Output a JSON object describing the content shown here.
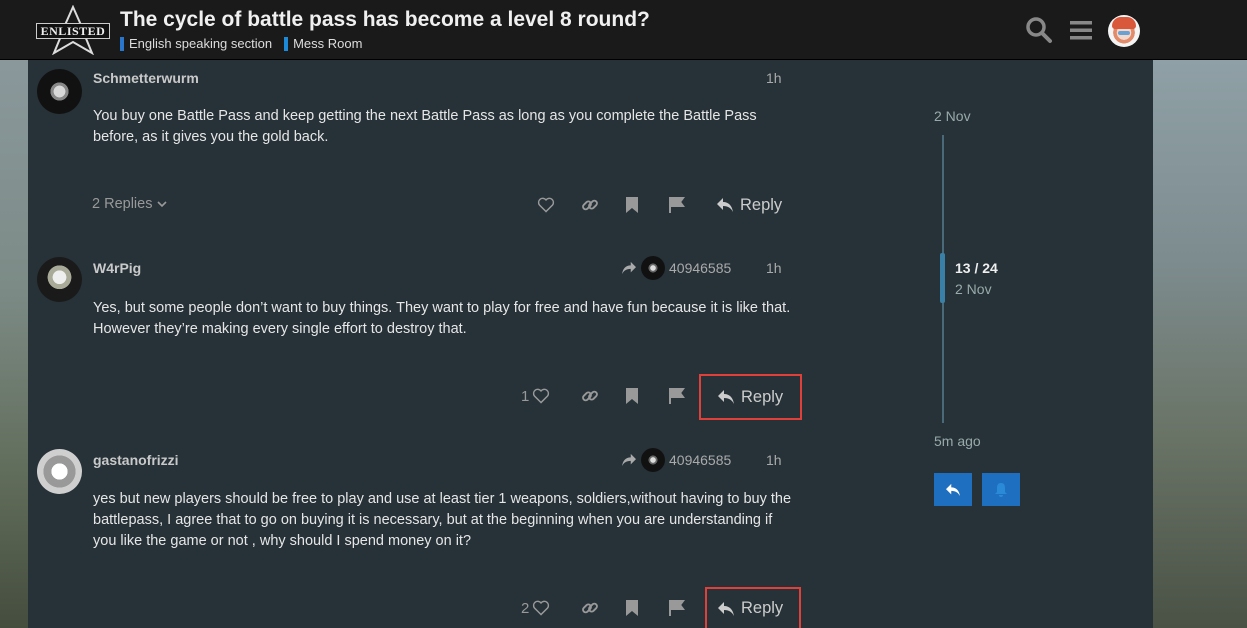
{
  "header": {
    "logo_text": "ENLISTED",
    "title": "The cycle of battle pass has become a level 8 round?",
    "crumbs": [
      {
        "label": "English speaking section",
        "color": "#2a76cc"
      },
      {
        "label": "Mess Room",
        "color": "#1c8ad8"
      }
    ]
  },
  "posts": [
    {
      "username": "Schmetterwurm",
      "time": "1h",
      "body": "You buy one Battle Pass and keep getting the next Battle Pass as long as you complete the Battle Pass before, as it gives you the gold back.",
      "replies_label": "2 Replies",
      "reply_label": "Reply"
    },
    {
      "username": "W4rPig",
      "reply_to": "40946585",
      "time": "1h",
      "body": "Yes, but some people don’t want to buy things. They want to play for free and have fun because it is like that. However they’re making every single effort to destroy that.",
      "like_count": "1",
      "reply_label": "Reply"
    },
    {
      "username": "gastanofrizzi",
      "reply_to": "40946585",
      "time": "1h",
      "body": "yes but new players should be free to play and use at least tier 1 weapons, soldiers,without having to buy the battlepass, I agree that to go on buying it is necessary, but at the beginning when you are understanding if you like the game or not , why should I spend money on it?",
      "like_count": "2",
      "reply_label": "Reply"
    }
  ],
  "timeline": {
    "start_date": "2 Nov",
    "position": "13 / 24",
    "position_date": "2 Nov",
    "end_label": "5m ago"
  },
  "colors": {
    "accent": "#1e6fbf",
    "highlight_box": "#e0403a",
    "post_bg": "#263238"
  }
}
